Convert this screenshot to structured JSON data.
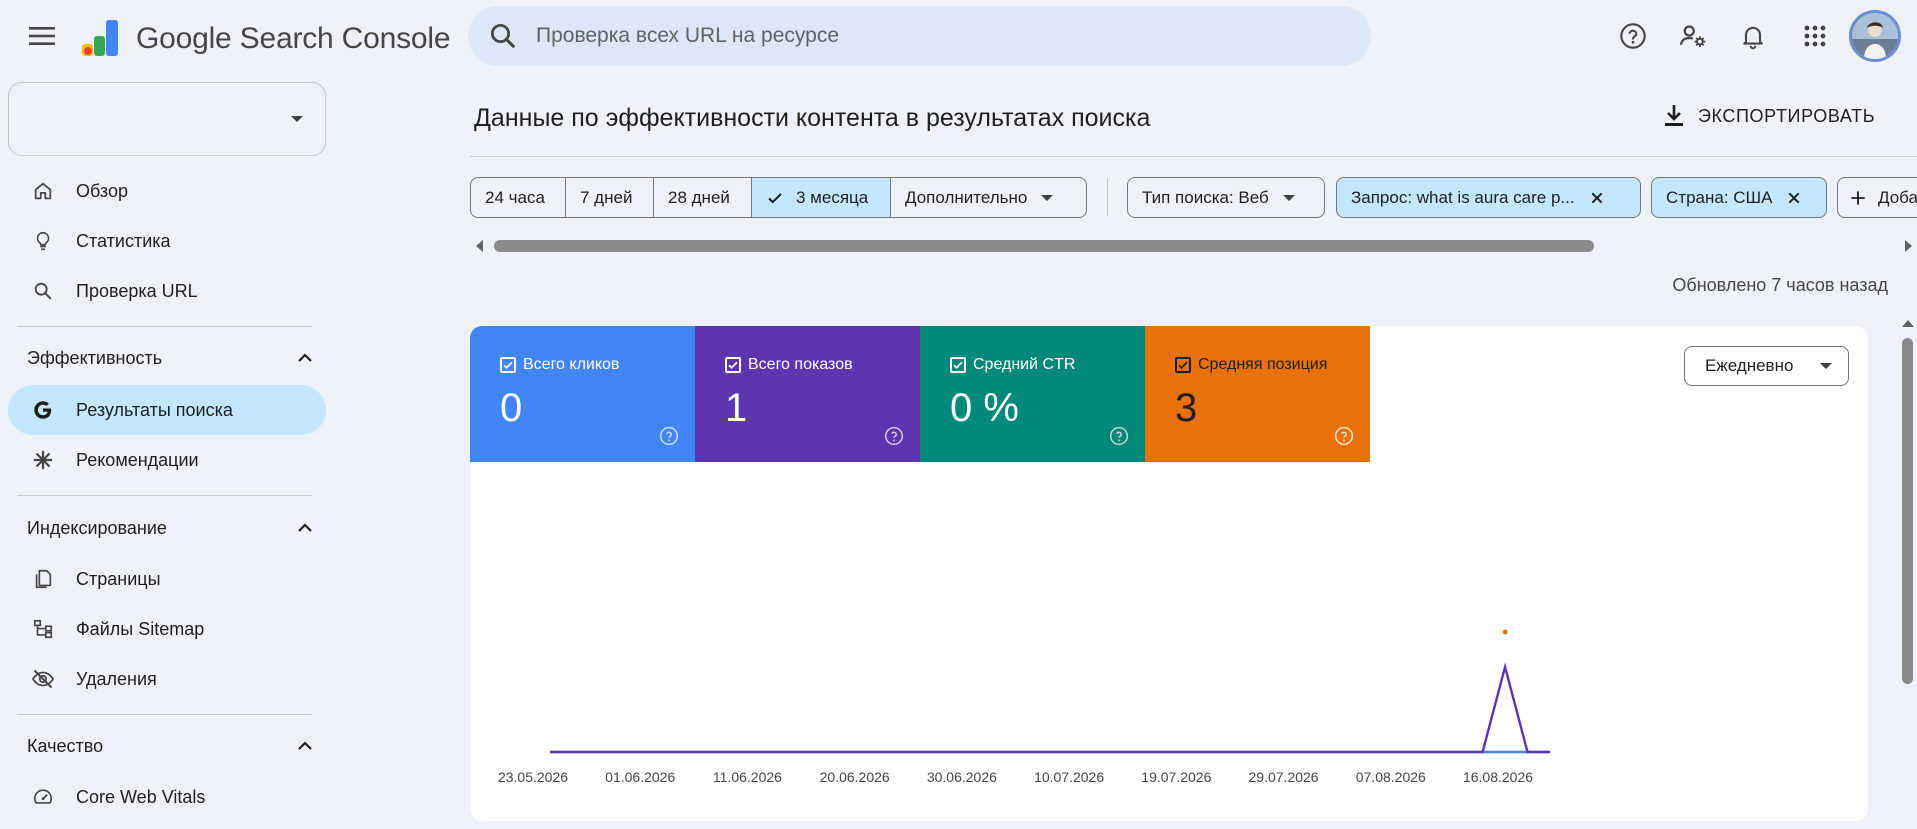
{
  "header": {
    "brand": "Google Search Console",
    "search_placeholder": "Проверка всех URL на ресурсе"
  },
  "icons": {
    "menu": "menu-icon",
    "search": "search-icon",
    "help": "help-icon",
    "settings": "manage-accounts-icon",
    "notifications": "bell-icon",
    "apps": "apps-icon"
  },
  "sidebar": {
    "property": "",
    "items_top": [
      {
        "label": "Обзор",
        "icon": "home-icon"
      },
      {
        "label": "Статистика",
        "icon": "lightbulb-icon"
      },
      {
        "label": "Проверка URL",
        "icon": "search-icon"
      }
    ],
    "sections": [
      {
        "title": "Эффективность",
        "items": [
          {
            "label": "Результаты поиска",
            "icon": "google-g-icon",
            "active": true
          },
          {
            "label": "Рекомендации",
            "icon": "asterisk-icon"
          }
        ]
      },
      {
        "title": "Индексирование",
        "items": [
          {
            "label": "Страницы",
            "icon": "pages-icon"
          },
          {
            "label": "Файлы Sitemap",
            "icon": "sitemap-icon"
          },
          {
            "label": "Удаления",
            "icon": "visibility-off-icon"
          }
        ]
      },
      {
        "title": "Качество",
        "items": [
          {
            "label": "Core Web Vitals",
            "icon": "speed-icon"
          }
        ]
      }
    ]
  },
  "main": {
    "title": "Данные по эффективности контента в результатах поиска",
    "export_label": "ЭКСПОРТИРОВАТЬ",
    "date_ranges": [
      "24 часа",
      "7 дней",
      "28 дней",
      "3 месяца",
      "Дополнительно"
    ],
    "selected_range": "3 месяца",
    "filters": {
      "search_type": "Тип поиска: Веб",
      "query": "Запрос: what is aura care p...",
      "country": "Страна: США",
      "add": "Доба"
    },
    "updated": "Обновлено 7 часов назад",
    "frequency": "Ежедневно",
    "metrics": [
      {
        "label": "Всего кликов",
        "value": "0",
        "color": "#4285f4"
      },
      {
        "label": "Всего показов",
        "value": "1",
        "color": "#5e35b1"
      },
      {
        "label": "Средний CTR",
        "value": "0 %",
        "color": "#00897b"
      },
      {
        "label": "Средняя позиция",
        "value": "3",
        "color": "#e8710a"
      }
    ]
  },
  "chart_data": {
    "type": "line",
    "x_tick_labels": [
      "23.05.2026",
      "01.06.2026",
      "11.06.2026",
      "20.06.2026",
      "30.06.2026",
      "10.07.2026",
      "19.07.2026",
      "29.07.2026",
      "07.08.2026",
      "16.08.2026"
    ],
    "x_start": "2026-05-23",
    "x_end": "2026-08-20",
    "series": [
      {
        "name": "Всего кликов",
        "color": "#4285f4",
        "points": [
          [
            "2026-05-23",
            0
          ],
          [
            "2026-08-20",
            0
          ]
        ]
      },
      {
        "name": "Всего показов",
        "color": "#5e35b1",
        "points": [
          [
            "2026-05-23",
            0
          ],
          [
            "2026-08-14",
            0
          ],
          [
            "2026-08-16",
            1
          ],
          [
            "2026-08-18",
            0
          ],
          [
            "2026-08-20",
            0
          ]
        ]
      },
      {
        "name": "Средняя позиция",
        "color": "#e8710a",
        "points": [
          [
            "2026-08-16",
            3
          ]
        ]
      }
    ]
  }
}
